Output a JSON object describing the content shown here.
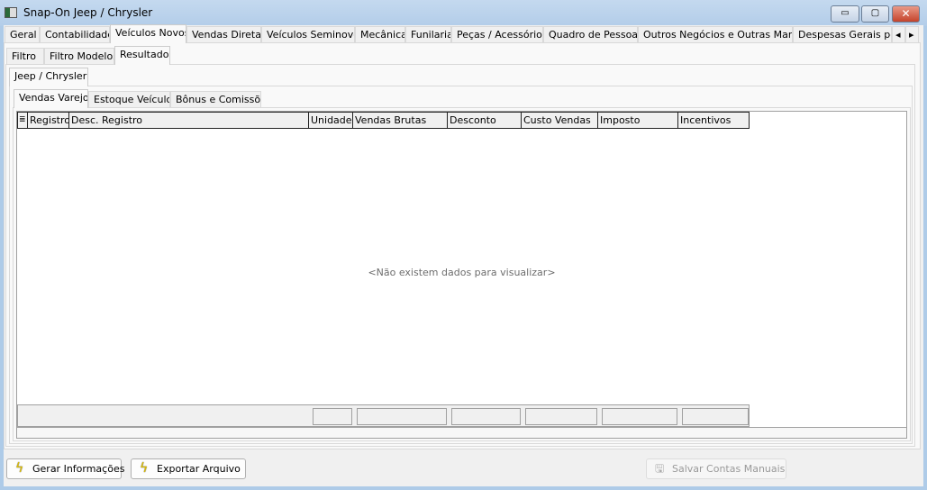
{
  "window": {
    "title": "Snap-On Jeep / Chrysler",
    "minimize": "▭",
    "maximize": "▢",
    "close": "✕"
  },
  "main_tabs": [
    "Geral",
    "Contabilidade",
    "Veículos Novos",
    "Vendas Diretas",
    "Veículos Seminovos",
    "Mecânica",
    "Funilaria",
    "Peças / Acessórios",
    "Quadro de Pessoas",
    "Outros Negócios e Outras Marcas",
    "Despesas Gerais por I"
  ],
  "main_tab_selected": "Veículos Novos",
  "tab_scroll": {
    "left": "◂",
    "right": "▸"
  },
  "sub_tabs": [
    "Filtro",
    "Filtro Modelos",
    "Resultado"
  ],
  "sub_tab_selected": "Resultado",
  "brand_tab": "Jeep / Chrysler",
  "result_tabs": [
    "Vendas Varejo",
    "Estoque Veículos",
    "Bônus e Comissões"
  ],
  "result_tab_selected": "Vendas Varejo",
  "grid": {
    "columns": [
      "Registro",
      "Desc. Registro",
      "Unidades",
      "Vendas Brutas",
      "Desconto",
      "Custo Vendas",
      "Imposto",
      "Incentivos"
    ],
    "empty_text": "<Não existem dados para visualizar>"
  },
  "buttons": {
    "generate": "Gerar Informações",
    "export": "Exportar Arquivo",
    "save": "Salvar Contas Manuais"
  }
}
